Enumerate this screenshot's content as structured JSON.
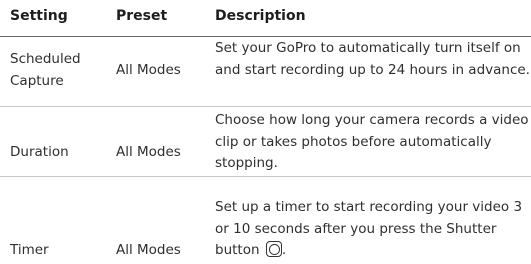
{
  "table": {
    "headers": {
      "setting": "Setting",
      "preset": "Preset",
      "description": "Description"
    },
    "rows": [
      {
        "setting_line1": "Scheduled",
        "setting_line2": "Capture",
        "preset": "All Modes",
        "description": "Set your GoPro to automatically turn itself on and start recording up to 24 hours in advance."
      },
      {
        "setting": "Duration",
        "preset": "All Modes",
        "description": "Choose how long your camera records a video clip or takes photos before automatically stopping."
      },
      {
        "setting": "Timer",
        "preset": "All Modes",
        "description_text": "Set up a timer to start recording your video 3 or 10 seconds after you press the Shutter button",
        "description_end": ".",
        "icon": "shutter-button-icon"
      }
    ]
  }
}
